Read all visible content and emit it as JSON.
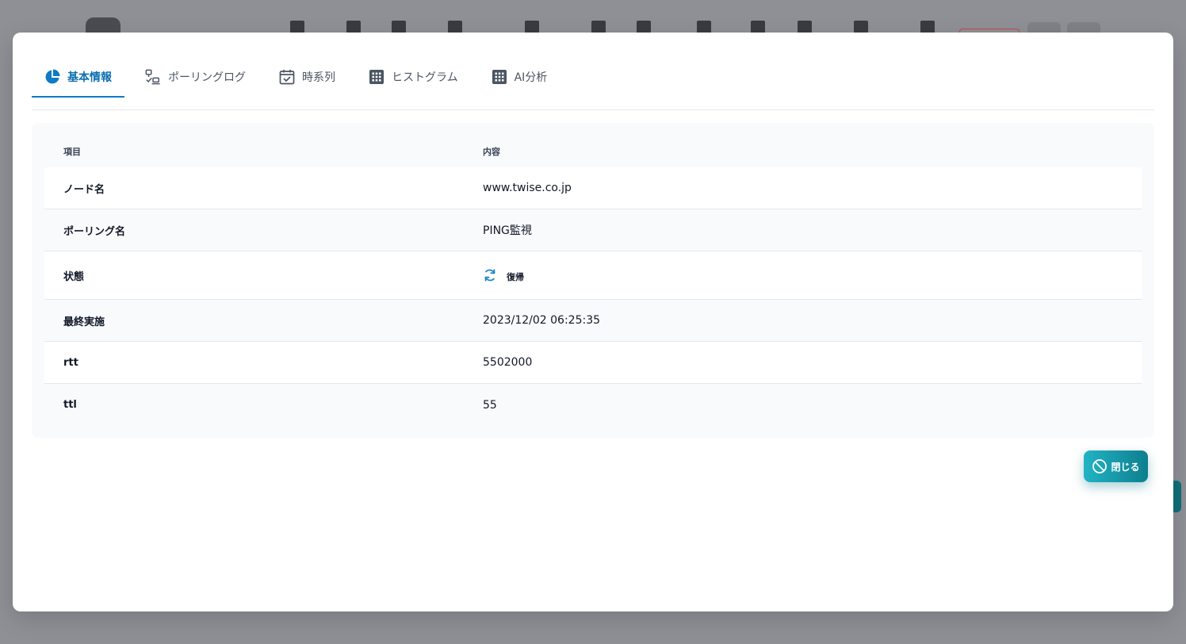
{
  "tabs": [
    {
      "label": "基本情報",
      "icon": "pie-chart-icon",
      "active": true
    },
    {
      "label": "ポーリングログ",
      "icon": "network-check-icon",
      "active": false
    },
    {
      "label": "時系列",
      "icon": "calendar-check-icon",
      "active": false
    },
    {
      "label": "ヒストグラム",
      "icon": "grid-icon",
      "active": false
    },
    {
      "label": "AI分析",
      "icon": "grid-icon",
      "active": false
    }
  ],
  "table": {
    "headers": {
      "item": "項目",
      "content": "内容"
    },
    "rows": [
      {
        "item": "ノード名",
        "value": "www.twise.co.jp"
      },
      {
        "item": "ポーリング名",
        "value": "PING監視"
      },
      {
        "item": "状態",
        "value": "復帰",
        "icon": "refresh-icon"
      },
      {
        "item": "最終実施",
        "value": "2023/12/02 06:25:35"
      },
      {
        "item": "rtt",
        "value": "5502000"
      },
      {
        "item": "ttl",
        "value": "55"
      }
    ]
  },
  "close_button": {
    "label": "閉じる",
    "icon": "ban-icon"
  },
  "colors": {
    "accent": "#0e7bc4",
    "status_icon": "#1f86c7",
    "close_button_start": "#22b3c4",
    "close_button_end": "#0d7f8f"
  }
}
